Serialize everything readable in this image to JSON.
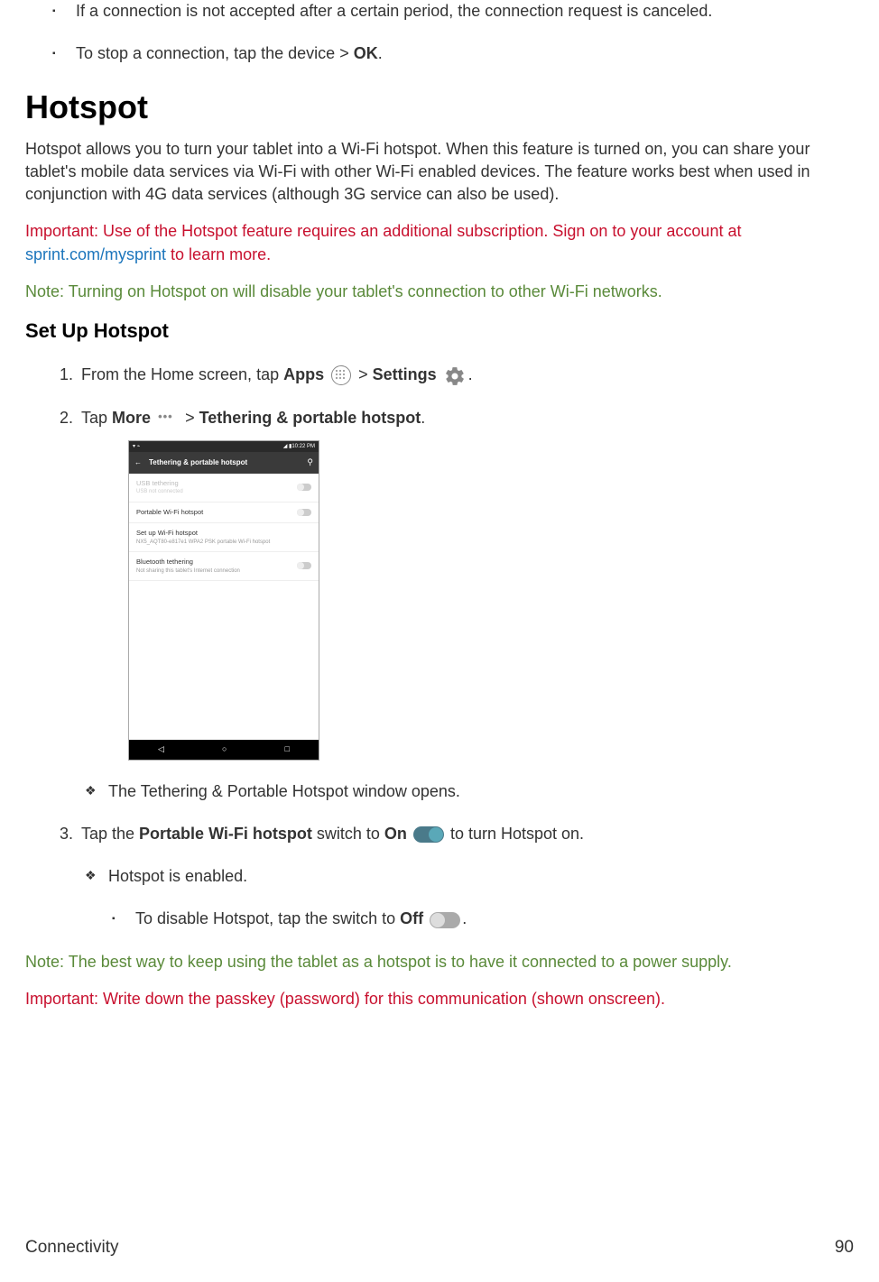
{
  "intro_bullets": [
    {
      "text": "If a connection is not accepted after a certain period, the connection request is canceled."
    },
    {
      "pre": "To stop a connection, tap the device > ",
      "bold": "OK",
      "post": "."
    }
  ],
  "hotspot": {
    "heading": "Hotspot",
    "description": "Hotspot allows you to turn your tablet into a Wi-Fi hotspot. When this feature is turned on, you can share your tablet's mobile data services via Wi-Fi with other Wi-Fi enabled devices. The feature works best when used in conjunction with 4G data services (although 3G service can also be used).",
    "important": {
      "label": "Important",
      "pre": ": Use of the Hotspot feature requires an additional subscription. Sign on to your account at ",
      "link": "sprint.com/mysprint",
      "post": " to learn more."
    },
    "note1": {
      "label": "Note",
      "text": ": Turning on Hotspot on will disable your tablet's connection to other Wi-Fi networks."
    }
  },
  "setup": {
    "heading": "Set Up Hotspot",
    "step1": {
      "pre": "From the Home screen, tap ",
      "apps": "Apps",
      "mid": " > ",
      "settings": "Settings",
      "post": "  ."
    },
    "step2": {
      "pre": "Tap ",
      "more": "More",
      "mid": " > ",
      "tethering": "Tethering & portable hotspot",
      "post": "."
    },
    "step2_sub": "The Tethering & Portable Hotspot window opens.",
    "step3": {
      "pre": "Tap the ",
      "bold1": "Portable Wi-Fi hotspot",
      "mid1": " switch to ",
      "bold2": "On",
      "post": " to turn Hotspot on."
    },
    "step3_sub1": "Hotspot is enabled.",
    "step3_sub2": {
      "pre": "To disable Hotspot, tap the switch to ",
      "bold": "Off",
      "post": "."
    }
  },
  "note2": {
    "label": "Note",
    "text": ": The best way to keep using the tablet as a hotspot is to have it connected to a power supply."
  },
  "important2": {
    "label": "Important",
    "text": ": Write down the passkey (password) for this communication (shown onscreen)."
  },
  "screenshot": {
    "status_time": "10:22 PM",
    "header_title": "Tethering & portable hotspot",
    "row1": {
      "title": "USB tethering",
      "sub": "USB not connected"
    },
    "row2": {
      "title": "Portable Wi-Fi hotspot"
    },
    "row3": {
      "title": "Set up Wi-Fi hotspot",
      "sub": "NX5_AQT80-e817e1 WPA2 PSK portable Wi-Fi hotspot"
    },
    "row4": {
      "title": "Bluetooth tethering",
      "sub": "Not sharing this tablet's Internet connection"
    }
  },
  "footer": {
    "section": "Connectivity",
    "page": "90"
  }
}
